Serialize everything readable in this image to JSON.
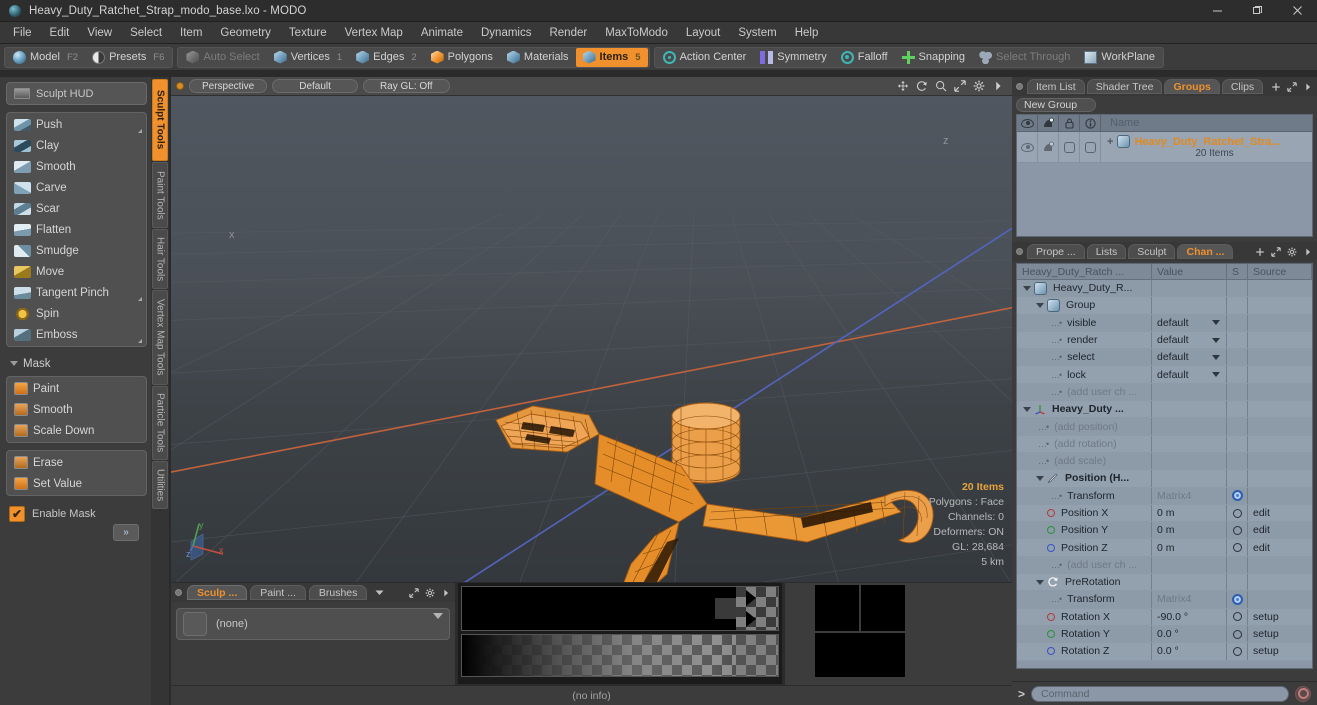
{
  "window": {
    "title": "Heavy_Duty_Ratchet_Strap_modo_base.lxo - MODO",
    "app_icon": "modo-sphere-icon",
    "minimize": "—",
    "maximize": "❐",
    "close": "✕"
  },
  "menubar": {
    "items": [
      "File",
      "Edit",
      "View",
      "Select",
      "Item",
      "Geometry",
      "Texture",
      "Vertex Map",
      "Animate",
      "Dynamics",
      "Render",
      "MaxToModo",
      "Layout",
      "System",
      "Help"
    ]
  },
  "toolbar": {
    "layout_group": [
      {
        "label": "Model",
        "key": "F2",
        "icon": "sphere-icon",
        "selected": false
      },
      {
        "label": "Presets",
        "key": "F6",
        "icon": "half-sphere-icon",
        "selected": false
      }
    ],
    "component_group": [
      {
        "label": "Auto Select",
        "key": "",
        "icon": "cube-grey-icon",
        "selected": false,
        "disabled": true
      },
      {
        "label": "Vertices",
        "key": "1",
        "icon": "cube-blue-icon",
        "selected": false,
        "disabled": false
      },
      {
        "label": "Edges",
        "key": "2",
        "icon": "cube-blue-icon",
        "selected": false,
        "disabled": false
      },
      {
        "label": "Polygons",
        "key": "",
        "icon": "cube-orange-icon",
        "selected": false,
        "disabled": false
      },
      {
        "label": "Materials",
        "key": "",
        "icon": "cube-blue-icon",
        "selected": false,
        "disabled": false
      },
      {
        "label": "Items",
        "key": "5",
        "icon": "cube-orange-icon",
        "selected": true,
        "disabled": false
      }
    ],
    "action_group": [
      {
        "label": "Action Center",
        "icon": "action-center-icon",
        "disabled": false
      },
      {
        "label": "Symmetry",
        "icon": "symmetry-icon",
        "disabled": false
      },
      {
        "label": "Falloff",
        "icon": "falloff-icon",
        "disabled": false
      },
      {
        "label": "Snapping",
        "icon": "snapping-icon",
        "disabled": false
      },
      {
        "label": "Select Through",
        "icon": "select-through-icon",
        "disabled": true
      },
      {
        "label": "WorkPlane",
        "icon": "workplane-icon",
        "disabled": false
      }
    ]
  },
  "left_panel": {
    "hud": {
      "label": "Sculpt HUD",
      "icon": "hud-icon"
    },
    "sculpt_tools": [
      {
        "label": "Push",
        "icon": "brush-push-icon",
        "has_corner": true
      },
      {
        "label": "Clay",
        "icon": "brush-clay-icon",
        "has_corner": false
      },
      {
        "label": "Smooth",
        "icon": "brush-smooth-icon",
        "has_corner": false
      },
      {
        "label": "Carve",
        "icon": "brush-carve-icon",
        "has_corner": false
      },
      {
        "label": "Scar",
        "icon": "brush-scar-icon",
        "has_corner": false
      },
      {
        "label": "Flatten",
        "icon": "brush-flatten-icon",
        "has_corner": false
      },
      {
        "label": "Smudge",
        "icon": "brush-smudge-icon",
        "has_corner": false
      },
      {
        "label": "Move",
        "icon": "brush-move-icon",
        "has_corner": false
      },
      {
        "label": "Tangent Pinch",
        "icon": "brush-pinch-icon",
        "has_corner": true
      },
      {
        "label": "Spin",
        "icon": "brush-spin-icon",
        "has_corner": false
      },
      {
        "label": "Emboss",
        "icon": "brush-emboss-icon",
        "has_corner": true
      }
    ],
    "mask_section": {
      "header": "Mask",
      "group_a": [
        {
          "label": "Paint",
          "icon": "mask-paint-icon"
        },
        {
          "label": "Smooth",
          "icon": "mask-smooth-icon"
        },
        {
          "label": "Scale Down",
          "icon": "mask-scaledown-icon"
        }
      ],
      "group_b": [
        {
          "label": "Erase",
          "icon": "mask-erase-icon"
        },
        {
          "label": "Set Value",
          "icon": "mask-setvalue-icon"
        }
      ],
      "enable_mask": {
        "label": "Enable Mask",
        "checked": true,
        "check_glyph": "✔"
      },
      "more_button": "»"
    },
    "side_tabs": [
      {
        "label": "Sculpt Tools",
        "selected": true
      },
      {
        "label": "Paint Tools",
        "selected": false
      },
      {
        "label": "Hair Tools",
        "selected": false
      },
      {
        "label": "Vertex Map Tools",
        "selected": false
      },
      {
        "label": "Particle Tools",
        "selected": false
      },
      {
        "label": "Utilities",
        "selected": false
      }
    ]
  },
  "viewport": {
    "header": {
      "view_mode": "Perspective",
      "shading": "Default",
      "raygl": "Ray GL: Off",
      "nav_icons": [
        "pan-icon",
        "rotate-icon",
        "zoom-icon",
        "expand-icon",
        "gear-icon",
        "chevron-right-icon"
      ]
    },
    "info": {
      "items": "20 Items",
      "polygons": "Polygons : Face",
      "channels": "Channels: 0",
      "deformers": "Deformers: ON",
      "gl": "GL: 28,684",
      "scale": "5 km"
    },
    "axis_gizmo": {
      "x": "x",
      "y": "y",
      "z": "z"
    },
    "model_name": "Heavy_Duty_Ratchet_Strap wireframe",
    "wire_color": "#f0912d"
  },
  "bottom_left": {
    "tabs": [
      {
        "label": "Sculp ...",
        "selected": true
      },
      {
        "label": "Paint ...",
        "selected": false
      },
      {
        "label": "Brushes",
        "selected": false
      }
    ],
    "tab_extra_icons": [
      "chevron-down-icon",
      "expand-icon",
      "gear-icon",
      "chevron-right-icon"
    ],
    "swatch_value": "(none)"
  },
  "status_bar": {
    "text": "(no info)"
  },
  "right_panel": {
    "top_tabs": [
      {
        "label": "Item List",
        "selected": false
      },
      {
        "label": "Shader Tree",
        "selected": false
      },
      {
        "label": "Groups",
        "selected": true
      },
      {
        "label": "Clips",
        "selected": false
      }
    ],
    "top_tab_icons": [
      "plus-icon",
      "expand-icon",
      "chevron-right-icon"
    ],
    "new_group_button": "New Group",
    "group_list": {
      "columns": [
        "eye-icon",
        "render-icon",
        "lock-icon",
        "info-icon",
        "Name"
      ],
      "rows": [
        {
          "name": "Heavy_Duty_Ratchet_Stra...",
          "sub": "20 Items",
          "expand": "+",
          "icon": "group-cube-icon"
        }
      ]
    },
    "bottom_tabs": [
      {
        "label": "Prope ...",
        "selected": false
      },
      {
        "label": "Lists",
        "selected": false
      },
      {
        "label": "Sculpt",
        "selected": false
      },
      {
        "label": "Chan ...",
        "selected": true
      }
    ],
    "bottom_tab_icons": [
      "plus-icon",
      "expand-icon",
      "gear-icon",
      "chevron-right-icon"
    ],
    "channels": {
      "headers": [
        "Heavy_Duty_Ratch ...",
        "Value",
        "S",
        "Source"
      ],
      "rows": [
        {
          "indent": 0,
          "twisty": true,
          "icon": "group-cube-icon",
          "name": "Heavy_Duty_R...",
          "value": "",
          "s": "",
          "source": "",
          "bold": false,
          "dim": false
        },
        {
          "indent": 1,
          "twisty": true,
          "icon": "group-cube-icon",
          "name": "Group",
          "value": "",
          "s": "",
          "source": "",
          "bold": false,
          "dim": false
        },
        {
          "indent": 2,
          "twisty": false,
          "icon": "dash",
          "name": "visible",
          "value": "default",
          "dropdown": true,
          "s": "",
          "source": "",
          "bold": false,
          "dim": false
        },
        {
          "indent": 2,
          "twisty": false,
          "icon": "dash",
          "name": "render",
          "value": "default",
          "dropdown": true,
          "s": "",
          "source": "",
          "bold": false,
          "dim": false
        },
        {
          "indent": 2,
          "twisty": false,
          "icon": "dash",
          "name": "select",
          "value": "default",
          "dropdown": true,
          "s": "",
          "source": "",
          "bold": false,
          "dim": false
        },
        {
          "indent": 2,
          "twisty": false,
          "icon": "dash",
          "name": "lock",
          "value": "default",
          "dropdown": true,
          "s": "",
          "source": "",
          "bold": false,
          "dim": false
        },
        {
          "indent": 2,
          "twisty": false,
          "icon": "dash",
          "name": "(add user ch  ...",
          "value": "",
          "s": "",
          "source": "",
          "bold": false,
          "dim": true
        },
        {
          "indent": 0,
          "twisty": true,
          "icon": "locator-icon",
          "name": "Heavy_Duty ...",
          "value": "",
          "s": "",
          "source": "",
          "bold": true,
          "dim": false
        },
        {
          "indent": 1,
          "twisty": false,
          "icon": "dash",
          "name": "(add position)",
          "value": "",
          "s": "",
          "source": "",
          "bold": false,
          "dim": true
        },
        {
          "indent": 1,
          "twisty": false,
          "icon": "dash",
          "name": "(add rotation)",
          "value": "",
          "s": "",
          "source": "",
          "bold": false,
          "dim": true
        },
        {
          "indent": 1,
          "twisty": false,
          "icon": "dash",
          "name": "(add scale)",
          "value": "",
          "s": "",
          "source": "",
          "bold": false,
          "dim": true
        },
        {
          "indent": 1,
          "twisty": true,
          "icon": "position-icon",
          "name": "Position (H...",
          "value": "",
          "s": "",
          "source": "",
          "bold": true,
          "dim": false
        },
        {
          "indent": 2,
          "twisty": false,
          "icon": "dash",
          "name": "Transform",
          "value": "Matrix4",
          "s": "radio-on",
          "source": "",
          "bold": false,
          "dim": false,
          "value_dim": true
        },
        {
          "indent": 2,
          "twisty": false,
          "icon": "dot-red",
          "name": "Position X",
          "value": "0 m",
          "s": "radio-off",
          "source": "edit",
          "bold": false,
          "dim": false
        },
        {
          "indent": 2,
          "twisty": false,
          "icon": "dot-green",
          "name": "Position Y",
          "value": "0 m",
          "s": "radio-off",
          "source": "edit",
          "bold": false,
          "dim": false
        },
        {
          "indent": 2,
          "twisty": false,
          "icon": "dot-blue",
          "name": "Position Z",
          "value": "0 m",
          "s": "radio-off",
          "source": "edit",
          "bold": false,
          "dim": false
        },
        {
          "indent": 2,
          "twisty": false,
          "icon": "dash",
          "name": "(add user ch  ...",
          "value": "",
          "s": "",
          "source": "",
          "bold": false,
          "dim": true
        },
        {
          "indent": 1,
          "twisty": true,
          "icon": "rotation-icon",
          "name": "PreRotation",
          "value": "",
          "s": "",
          "source": "",
          "bold": false,
          "dim": false
        },
        {
          "indent": 2,
          "twisty": false,
          "icon": "dash",
          "name": "Transform",
          "value": "Matrix4",
          "s": "radio-on",
          "source": "",
          "bold": false,
          "dim": false,
          "value_dim": true
        },
        {
          "indent": 2,
          "twisty": false,
          "icon": "dot-red",
          "name": "Rotation X",
          "value": "-90.0 °",
          "s": "radio-off",
          "source": "setup",
          "bold": false,
          "dim": false
        },
        {
          "indent": 2,
          "twisty": false,
          "icon": "dot-green",
          "name": "Rotation Y",
          "value": "0.0 °",
          "s": "radio-off",
          "source": "setup",
          "bold": false,
          "dim": false
        },
        {
          "indent": 2,
          "twisty": false,
          "icon": "dot-blue",
          "name": "Rotation Z",
          "value": "0.0 °",
          "s": "radio-off",
          "source": "setup",
          "bold": false,
          "dim": false
        }
      ]
    },
    "command_bar": {
      "prompt": ">",
      "placeholder": "Command",
      "record_icon": "record-icon"
    }
  }
}
